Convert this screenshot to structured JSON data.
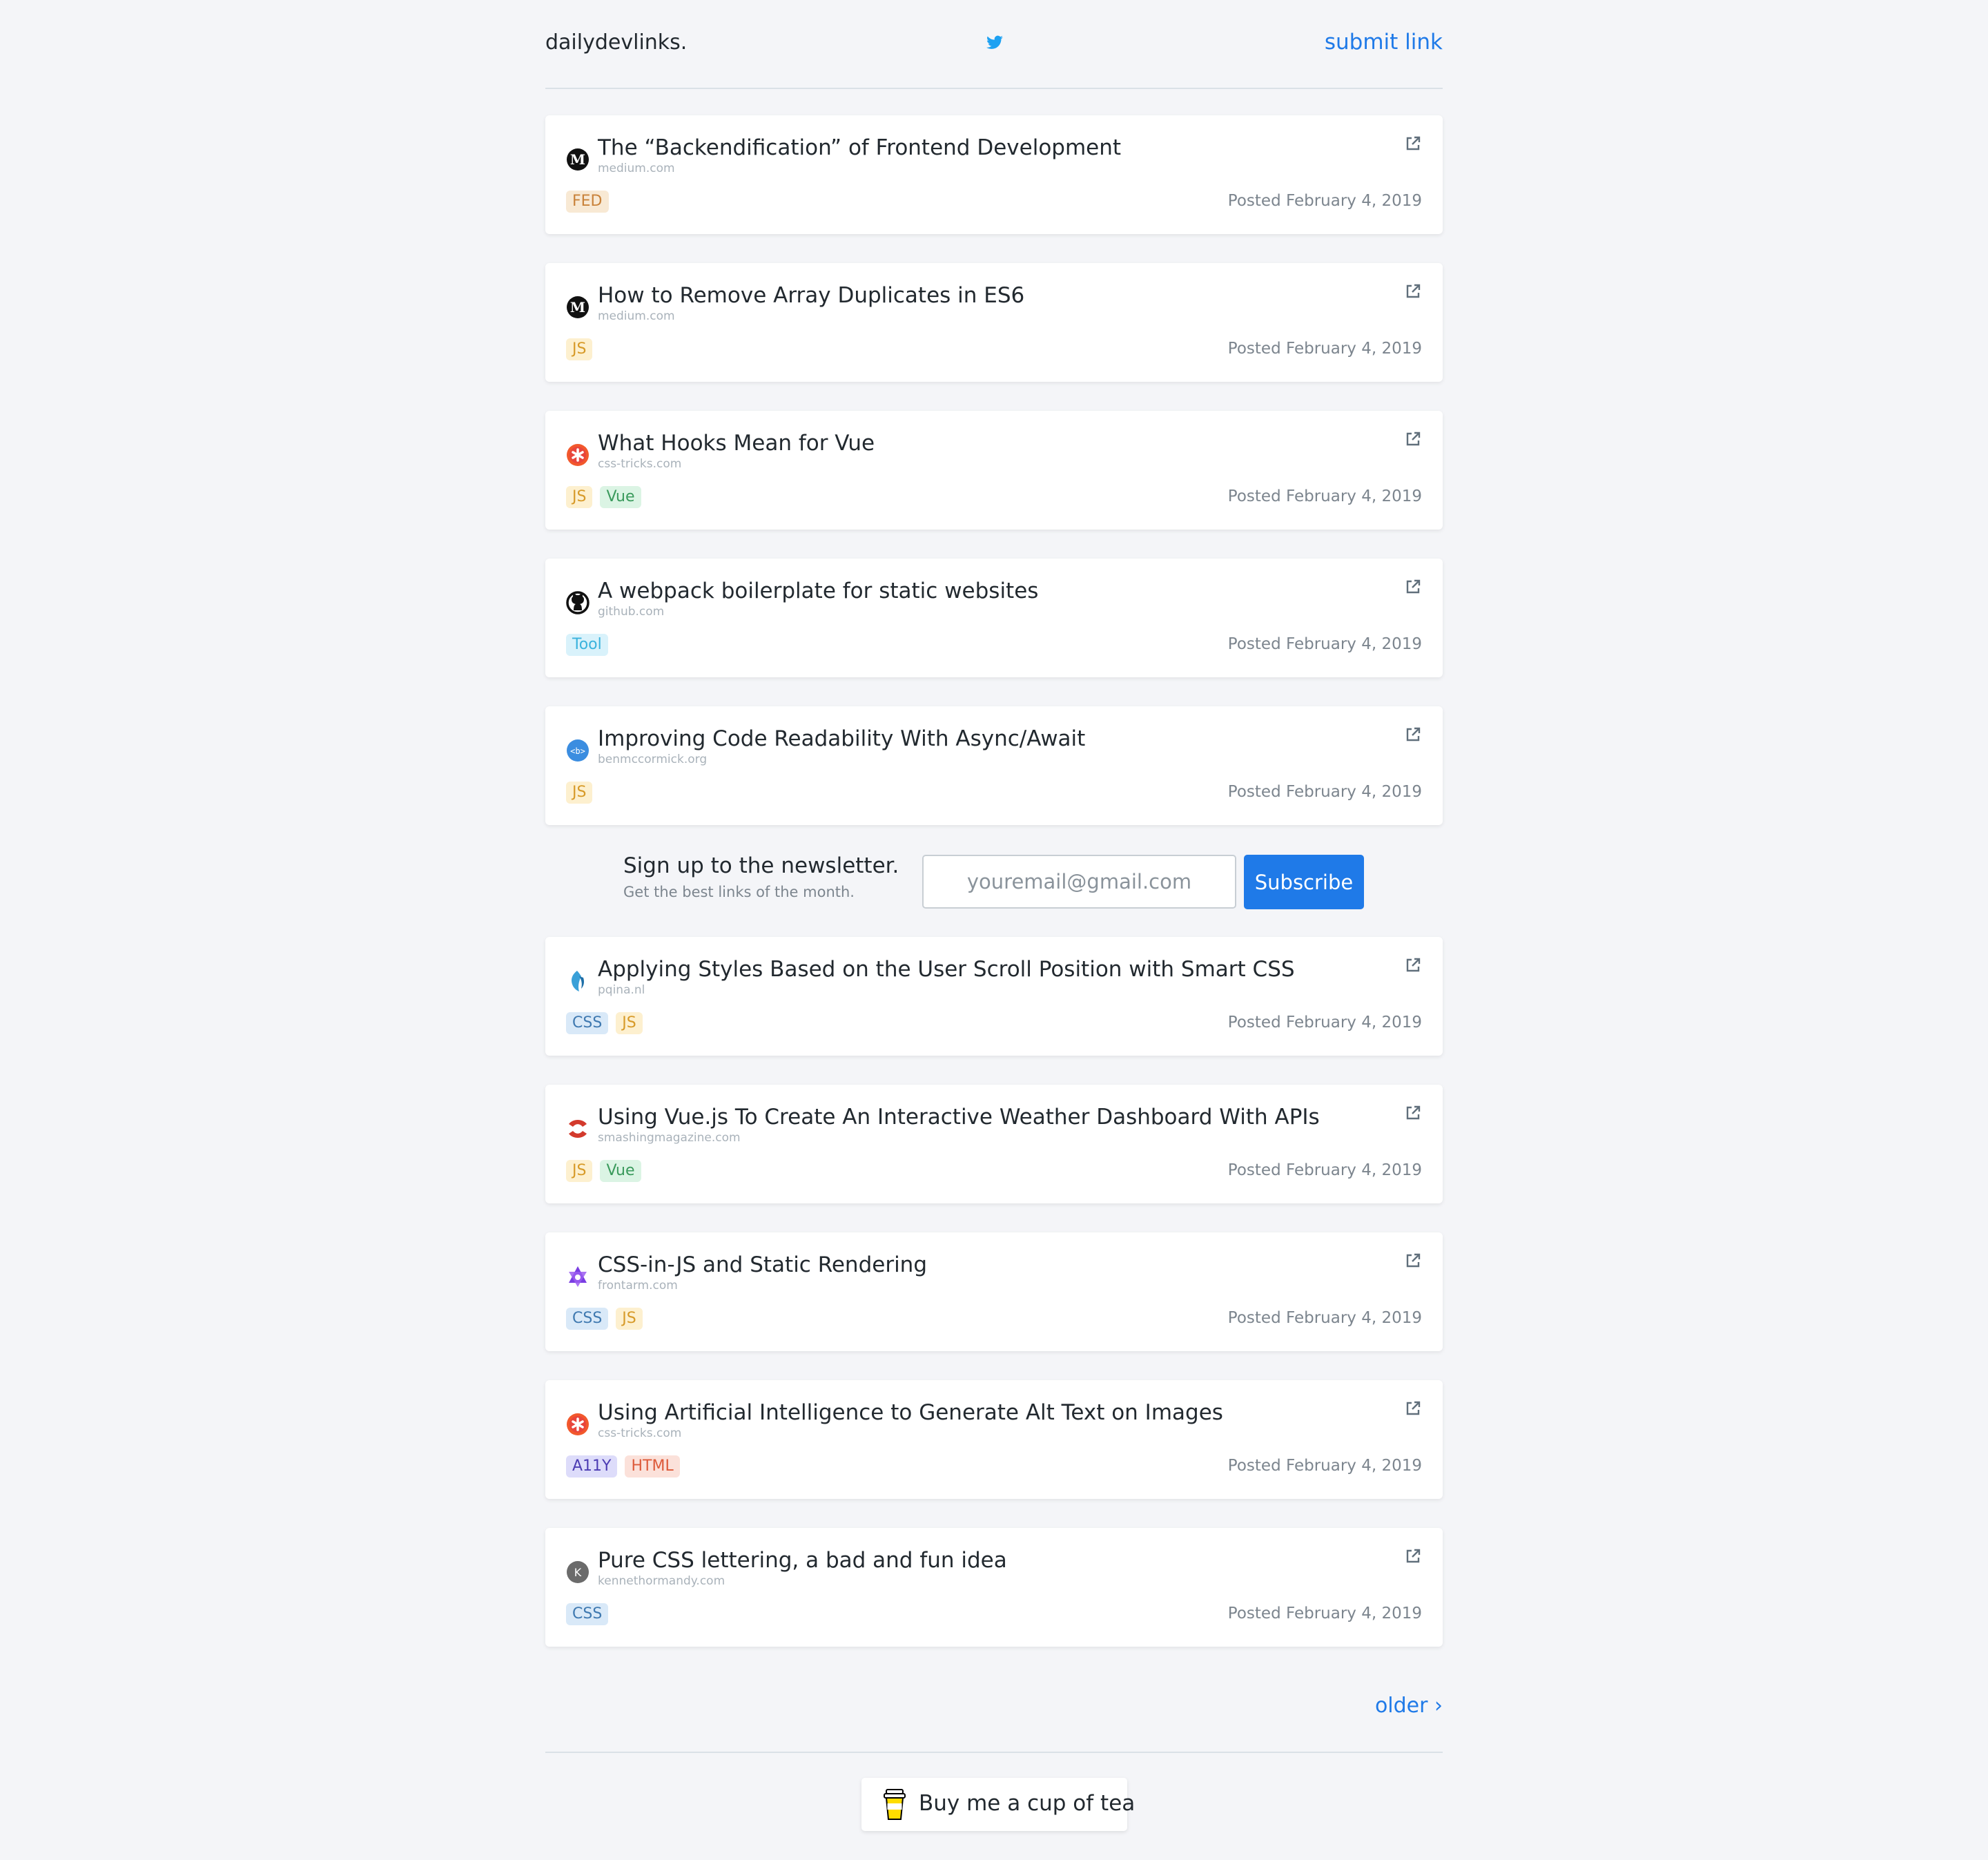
{
  "header": {
    "brand": "dailydevlinks.",
    "twitter_icon": "twitter-bird-icon",
    "submit_label": "submit link"
  },
  "posts": [
    {
      "title": "The “Backendification” of Frontend Development",
      "domain": "medium.com",
      "icon": "medium-logo-icon",
      "tags": [
        {
          "label": "FED",
          "kind": "fed"
        }
      ],
      "posted": "Posted February 4, 2019"
    },
    {
      "title": "How to Remove Array Duplicates in ES6",
      "domain": "medium.com",
      "icon": "medium-logo-icon",
      "tags": [
        {
          "label": "JS",
          "kind": "js"
        }
      ],
      "posted": "Posted February 4, 2019"
    },
    {
      "title": "What Hooks Mean for Vue",
      "domain": "css-tricks.com",
      "icon": "css-tricks-logo-icon",
      "tags": [
        {
          "label": "JS",
          "kind": "js"
        },
        {
          "label": "Vue",
          "kind": "vue"
        }
      ],
      "posted": "Posted February 4, 2019"
    },
    {
      "title": "A webpack boilerplate for static websites",
      "domain": "github.com",
      "icon": "github-logo-icon",
      "tags": [
        {
          "label": "Tool",
          "kind": "tool"
        }
      ],
      "posted": "Posted February 4, 2019"
    },
    {
      "title": "Improving Code Readability With Async/Await",
      "domain": "benmccormick.org",
      "icon": "benmccormick-logo-icon",
      "tags": [
        {
          "label": "JS",
          "kind": "js"
        }
      ],
      "posted": "Posted February 4, 2019"
    },
    {
      "title": "Applying Styles Based on the User Scroll Position with Smart CSS",
      "domain": "pqina.nl",
      "icon": "pqina-logo-icon",
      "tags": [
        {
          "label": "CSS",
          "kind": "css"
        },
        {
          "label": "JS",
          "kind": "js"
        }
      ],
      "posted": "Posted February 4, 2019"
    },
    {
      "title": "Using Vue.js To Create An Interactive Weather Dashboard With APIs",
      "domain": "smashingmagazine.com",
      "icon": "smashing-magazine-logo-icon",
      "tags": [
        {
          "label": "JS",
          "kind": "js"
        },
        {
          "label": "Vue",
          "kind": "vue"
        }
      ],
      "posted": "Posted February 4, 2019"
    },
    {
      "title": "CSS-in-JS and Static Rendering",
      "domain": "frontarm.com",
      "icon": "frontarm-logo-icon",
      "tags": [
        {
          "label": "CSS",
          "kind": "css"
        },
        {
          "label": "JS",
          "kind": "js"
        }
      ],
      "posted": "Posted February 4, 2019"
    },
    {
      "title": "Using Artificial Intelligence to Generate Alt Text on Images",
      "domain": "css-tricks.com",
      "icon": "css-tricks-logo-icon",
      "tags": [
        {
          "label": "A11Y",
          "kind": "a11y"
        },
        {
          "label": "HTML",
          "kind": "html"
        }
      ],
      "posted": "Posted February 4, 2019"
    },
    {
      "title": "Pure CSS lettering, a bad and fun idea",
      "domain": "kennethormandy.com",
      "icon": "kennethormandy-logo-icon",
      "tags": [
        {
          "label": "CSS",
          "kind": "css"
        }
      ],
      "posted": "Posted February 4, 2019"
    }
  ],
  "newsletter": {
    "title": "Sign up to the newsletter.",
    "subtitle": "Get the best links of the month.",
    "placeholder": "youremail@gmail.com",
    "button_label": "Subscribe"
  },
  "pagination": {
    "older_label": "older ›"
  },
  "footer": {
    "tea_label": "Buy me a cup of tea",
    "tea_icon": "tea-cup-icon"
  },
  "colors": {
    "accent": "#1f7ae8",
    "background": "#f4f5f8",
    "card": "#ffffff"
  }
}
